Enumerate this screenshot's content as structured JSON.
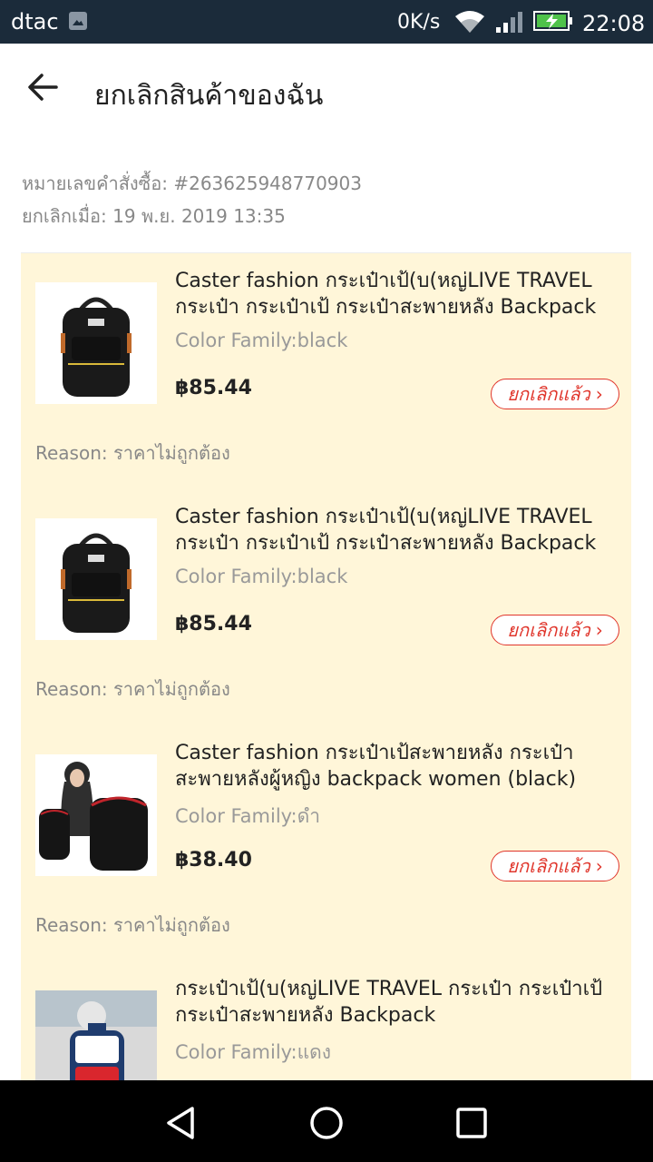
{
  "status_bar": {
    "carrier": "dtac",
    "speed": "0K/s",
    "time": "22:08",
    "icons": [
      "gallery-icon",
      "wifi-icon",
      "signal-icon",
      "battery-charging-icon"
    ]
  },
  "header": {
    "title": "ยกเลิกสินค้าของฉัน",
    "back_icon": "arrow-left-icon"
  },
  "order": {
    "number_label": "หมายเลขคำสั่งซื้อ: #263625948770903",
    "cancel_label": "ยกเลิกเมื่อ: 19 พ.ย. 2019 13:35"
  },
  "items": [
    {
      "name": "Caster fashion กระเป๋าเป้(บ(หญ่LIVE TRAVEL กระเป๋า กระเป๋าเป้ กระเป๋าสะพายหลัง Backpack",
      "variant": "Color Family:black",
      "price": "฿85.44",
      "status": "ยกเลิกแล้ว",
      "reason": "Reason: ราคาไม่ถูกต้อง",
      "image": "black-backpack-image"
    },
    {
      "name": "Caster fashion กระเป๋าเป้(บ(หญ่LIVE TRAVEL กระเป๋า กระเป๋าเป้ กระเป๋าสะพายหลัง Backpack",
      "variant": "Color Family:black",
      "price": "฿85.44",
      "status": "ยกเลิกแล้ว",
      "reason": "Reason: ราคาไม่ถูกต้อง",
      "image": "black-backpack-image"
    },
    {
      "name": "Caster fashion กระเป๋าเป้สะพายหลัง กระเป๋าสะพายหลังผู้หญิง backpack women (black)",
      "variant": "Color Family:ดำ",
      "price": "฿38.40",
      "status": "ยกเลิกแล้ว",
      "reason": "Reason: ราคาไม่ถูกต้อง",
      "image": "woman-with-backpack-image"
    },
    {
      "name": "กระเป๋าเป้(บ(หญ่LIVE TRAVEL กระเป๋า กระเป๋าเป้ กระเป๋าสะพายหลัง Backpack",
      "variant": "Color Family:แดง",
      "price": "",
      "status": "",
      "reason": "",
      "image": "red-backpack-image"
    }
  ],
  "nav": [
    "back-triangle-icon",
    "home-circle-icon",
    "recents-square-icon"
  ],
  "colors": {
    "status_bar": "#1b2b3a",
    "list_background": "#fff6d9",
    "cancel_badge": "#e0362c"
  }
}
